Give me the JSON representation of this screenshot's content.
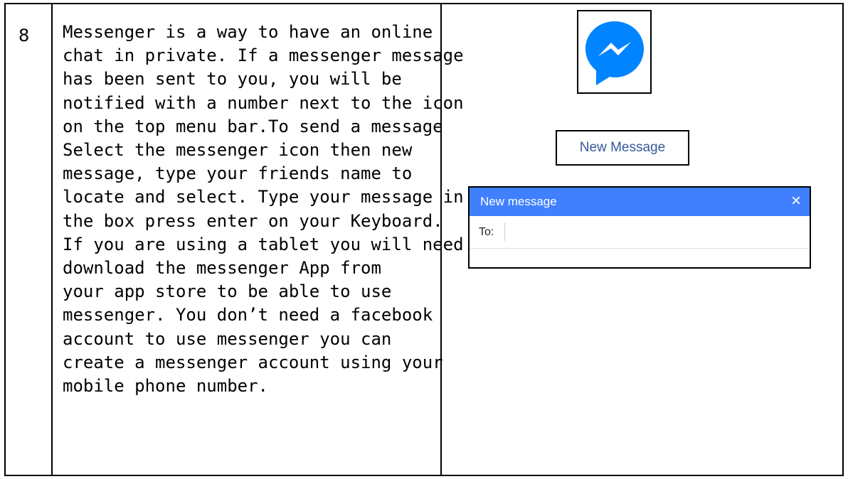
{
  "row": {
    "number": "8",
    "text_lines": [
      "Messenger is a way to have an online",
      "chat in private. If a messenger message",
      "has been sent to you, you will be",
      "notified with a number next to the icon",
      "on the top menu bar.To send a message",
      "Select the messenger icon then new",
      "message, type your friends name to",
      "locate and select. Type your message in",
      "the box press enter on your Keyboard.",
      "If you are using a tablet you will need to",
      "download the messenger App from",
      "your app store to be able to use",
      "messenger. You don’t need a facebook",
      "account to use messenger you can",
      "create a messenger account using your",
      "mobile phone number."
    ]
  },
  "messenger_icon": {
    "icon": "messenger-icon",
    "color": "#0084ff"
  },
  "new_message_button": {
    "label": "New Message",
    "color": "#365899"
  },
  "new_message_dialog": {
    "title": "New message",
    "close_icon": "×",
    "header_color": "#4080ff",
    "to_label": "To:",
    "to_value": ""
  }
}
